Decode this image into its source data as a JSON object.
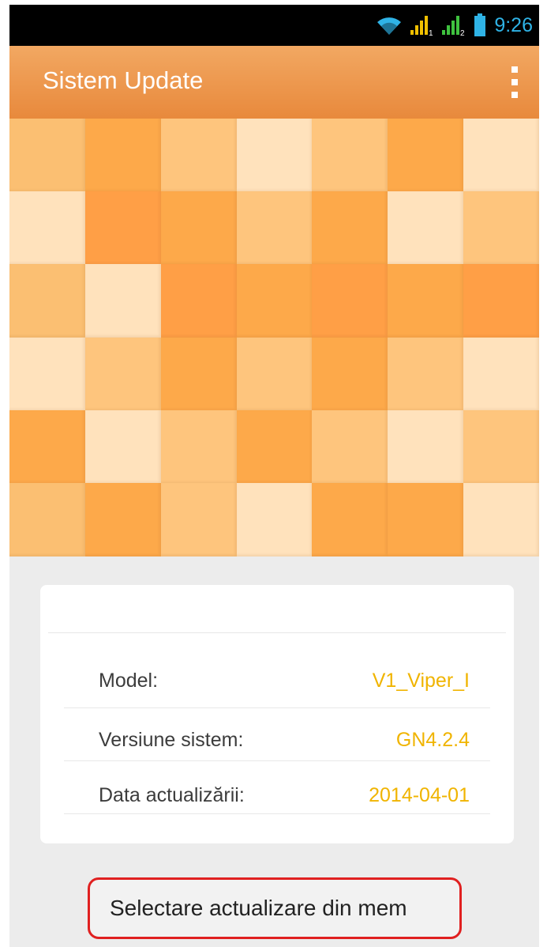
{
  "status_bar": {
    "time": "9:26",
    "icons": [
      "wifi-icon",
      "signal-sim1-icon",
      "signal-sim2-icon",
      "battery-icon"
    ]
  },
  "app_bar": {
    "title": "Sistem Update",
    "menu_icon": "overflow-menu-icon"
  },
  "banner": {
    "colors": [
      "#fbbf72",
      "#fda94a",
      "#fec57d",
      "#ffe2bc",
      "#ff9f46"
    ]
  },
  "info": {
    "rows": [
      {
        "label": "Model:",
        "value": "V1_Viper_I"
      },
      {
        "label": "Versiune sistem:",
        "value": "GN4.2.4"
      },
      {
        "label": "Data actualizării:",
        "value": "2014-04-01"
      }
    ]
  },
  "action": {
    "label": "Selectare actualizare din mem"
  },
  "colors": {
    "app_bar": "#ec9448",
    "value_text": "#f0b400",
    "status_time": "#2fb3e6"
  }
}
